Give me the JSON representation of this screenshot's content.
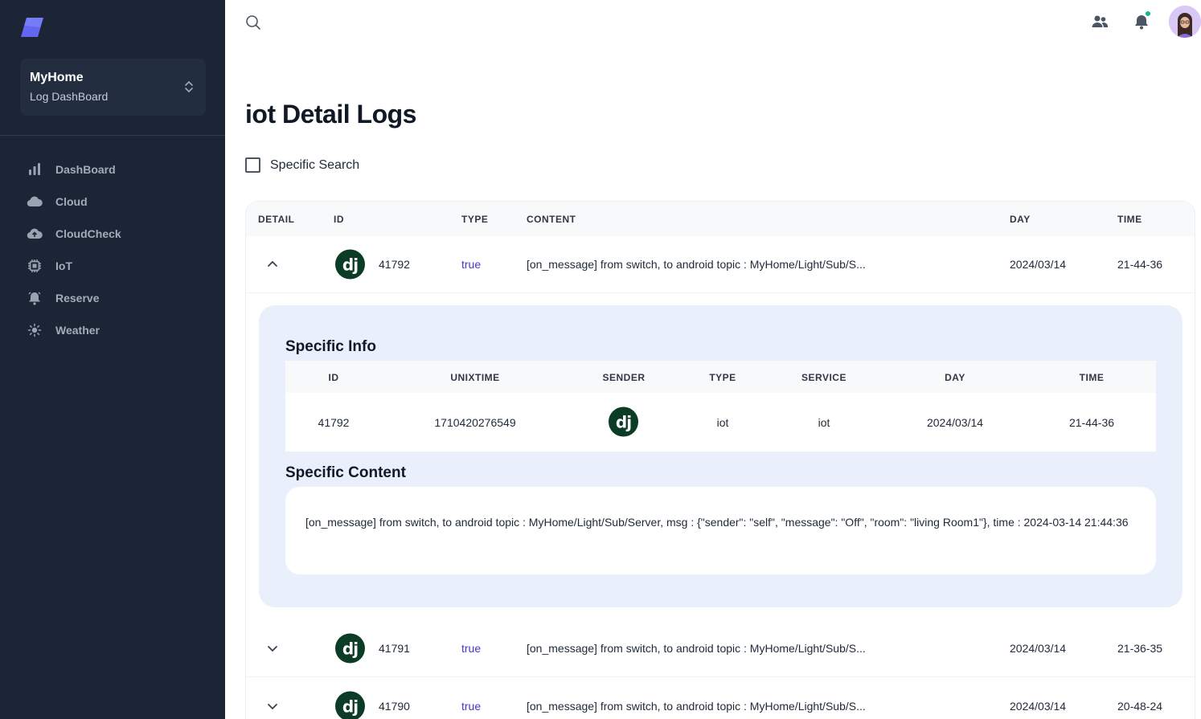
{
  "sidebar": {
    "workspace_title": "MyHome",
    "workspace_subtitle": "Log DashBoard",
    "items": [
      {
        "label": "DashBoard",
        "icon": "bar-chart-icon"
      },
      {
        "label": "Cloud",
        "icon": "cloud-icon"
      },
      {
        "label": "CloudCheck",
        "icon": "cloud-upload-icon"
      },
      {
        "label": "IoT",
        "icon": "chip-icon"
      },
      {
        "label": "Reserve",
        "icon": "alarm-bell-icon"
      },
      {
        "label": "Weather",
        "icon": "sun-icon"
      }
    ]
  },
  "header": {
    "notification_dot_color": "#10b981"
  },
  "page": {
    "title": "iot Detail Logs",
    "specific_search_label": "Specific Search"
  },
  "table": {
    "columns": [
      "DETAIL",
      "ID",
      "TYPE",
      "CONTENT",
      "DAY",
      "TIME"
    ],
    "rows": [
      {
        "id": "41792",
        "type": "true",
        "content": "[on_message] from switch, to android topic : MyHome/Light/Sub/S...",
        "day": "2024/03/14",
        "time": "21-44-36",
        "expanded": true
      },
      {
        "id": "41791",
        "type": "true",
        "content": "[on_message] from switch, to android topic : MyHome/Light/Sub/S...",
        "day": "2024/03/14",
        "time": "21-36-35",
        "expanded": false
      },
      {
        "id": "41790",
        "type": "true",
        "content": "[on_message] from switch, to android topic : MyHome/Light/Sub/S...",
        "day": "2024/03/14",
        "time": "20-48-24",
        "expanded": false
      }
    ],
    "avatar_text": "dj"
  },
  "detail": {
    "info_heading": "Specific Info",
    "info_columns": [
      "ID",
      "UNIXTIME",
      "SENDER",
      "TYPE",
      "SERVICE",
      "DAY",
      "TIME"
    ],
    "info_values": {
      "id": "41792",
      "unixtime": "1710420276549",
      "sender": "dj",
      "type": "iot",
      "service": "iot",
      "day": "2024/03/14",
      "time": "21-44-36"
    },
    "content_heading": "Specific Content",
    "content_text": "[on_message] from switch, to android topic : MyHome/Light/Sub/Server, msg : {\"sender\": \"self\", \"message\": \"Off\", \"room\": \"living Room1\"}, time : 2024-03-14 21:44:36"
  },
  "colors": {
    "sidebar_bg": "#1c2536",
    "accent": "#6366f1",
    "true_text": "#4338ca",
    "django_green": "#0c3c26"
  }
}
